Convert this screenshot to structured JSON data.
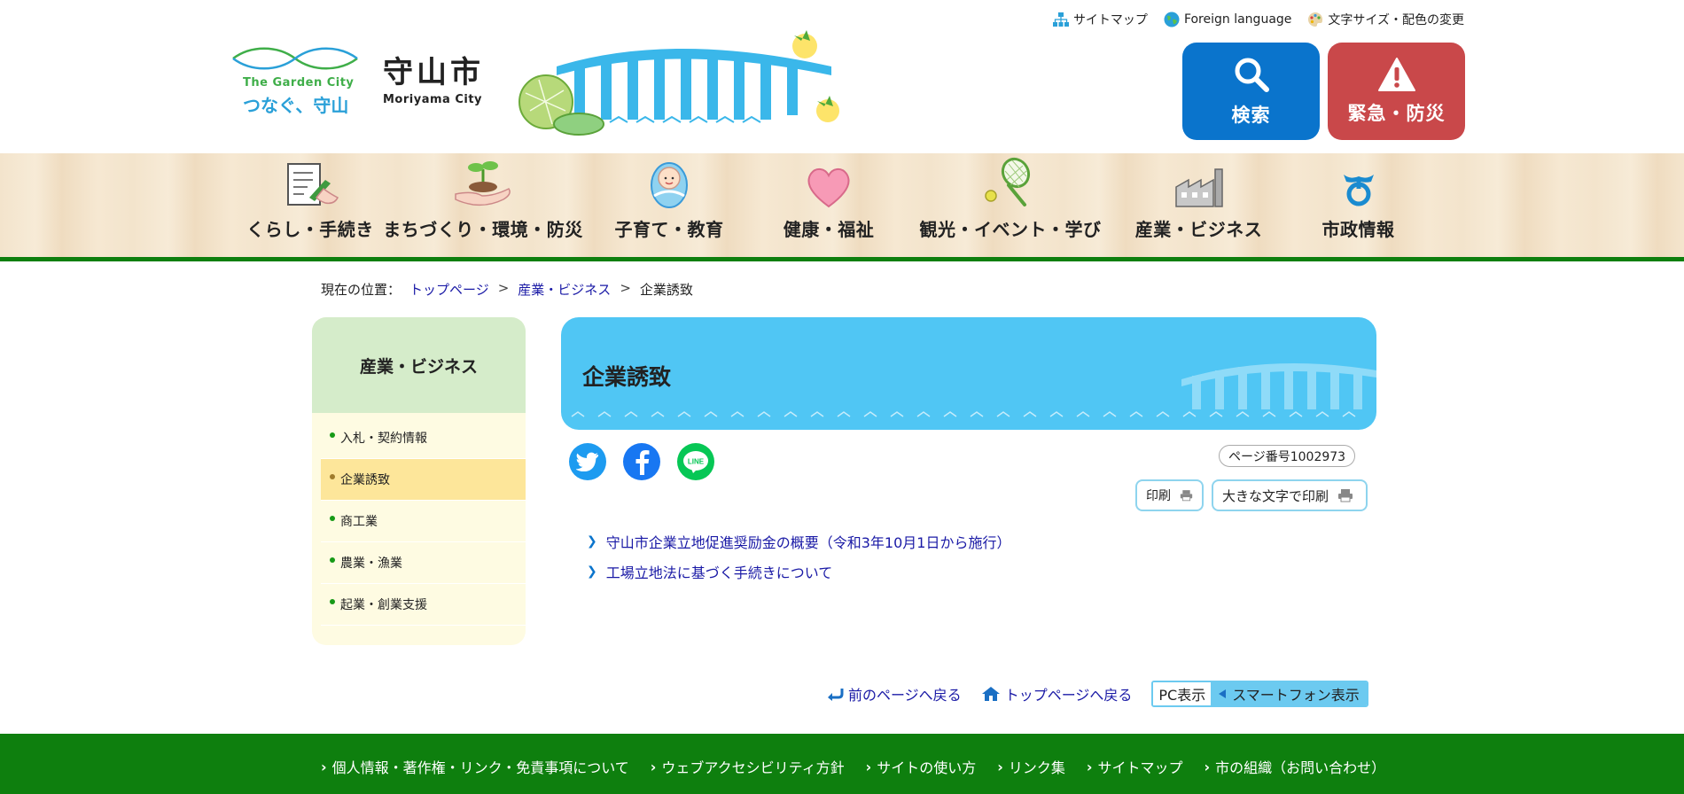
{
  "header": {
    "logo": {
      "catch_en": "The Garden City",
      "catch_jp": "つなぐ、守山"
    },
    "city_name_jp": "守山市",
    "city_name_en": "Moriyama City",
    "util_nav": [
      {
        "label": "サイトマップ",
        "icon": "sitemap-icon"
      },
      {
        "label": "Foreign language",
        "icon": "globe-icon"
      },
      {
        "label": "文字サイズ・配色の変更",
        "icon": "palette-icon"
      }
    ],
    "search_label": "検索",
    "emergency_label": "緊急・防災",
    "colors": {
      "search": "#0a74cc",
      "emergency": "#c9484a",
      "nav_border": "#0e7f0e"
    }
  },
  "gnav": [
    {
      "label": "くらし・手続き",
      "icon": "form-writing-icon"
    },
    {
      "label": "まちづくり・環境・防災",
      "icon": "sprout-hand-icon"
    },
    {
      "label": "子育て・教育",
      "icon": "baby-icon"
    },
    {
      "label": "健康・福祉",
      "icon": "heart-icon"
    },
    {
      "label": "観光・イベント・学び",
      "icon": "tennis-racket-icon"
    },
    {
      "label": "産業・ビジネス",
      "icon": "factory-icon"
    },
    {
      "label": "市政情報",
      "icon": "city-emblem-icon"
    }
  ],
  "breadcrumb": {
    "prefix": "現在の位置：",
    "items": [
      "トップページ",
      "産業・ビジネス"
    ],
    "current": "企業誘致",
    "separator": ">"
  },
  "sidebar": {
    "title": "産業・ビジネス",
    "items": [
      {
        "label": "入札・契約情報",
        "current": false
      },
      {
        "label": "企業誘致",
        "current": true
      },
      {
        "label": "商工業",
        "current": false
      },
      {
        "label": "農業・漁業",
        "current": false
      },
      {
        "label": "起業・創業支援",
        "current": false
      }
    ]
  },
  "main": {
    "title": "企業誘致",
    "page_number": "ページ番号1002973",
    "print_label": "印刷",
    "print_large_label": "大きな文字で印刷",
    "social": [
      "twitter-icon",
      "facebook-icon",
      "line-icon"
    ],
    "links": [
      "守山市企業立地促進奨励金の概要（令和3年10月1日から施行）",
      "工場立地法に基づく手続きについて"
    ]
  },
  "page_nav": {
    "back_label": "前のページへ戻る",
    "top_label": "トップページへ戻る",
    "pc_label": "PC表示",
    "sp_label": "スマートフォン表示"
  },
  "footer": {
    "links": [
      "個人情報・著作権・リンク・免責事項について",
      "ウェブアクセシビリティ方針",
      "サイトの使い方",
      "リンク集",
      "サイトマップ",
      "市の組織（お問い合わせ）"
    ]
  }
}
